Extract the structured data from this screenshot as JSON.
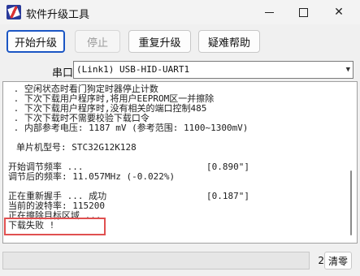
{
  "window": {
    "title": "软件升级工具",
    "minimize": "minimize",
    "maximize": "maximize",
    "close": "✕"
  },
  "toolbar": {
    "start_label": "开始升级",
    "stop_label": "停止",
    "retry_label": "重复升级",
    "help_label": "疑难帮助"
  },
  "port": {
    "label": "串口",
    "value": "(Link1) USB-HID-UART1"
  },
  "log": {
    "lines": [
      " . 空闲状态时看门狗定时器停止计数",
      " . 下次下载用户程序时,将用户EEPROM区一并擦除",
      " . 下次下载用户程序时,没有相关的端口控制485",
      " . 下次下载时不需要校验下载口令",
      " . 内部参考电压: 1187 mV (参考范围: 1100~1300mV)",
      "单片机型号: STC32G12K128",
      "开始调节频率 ...",
      "调节后的频率: 11.057MHz (-0.022%)",
      "正在重新握手 ... 成功",
      "当前的波特率: 115200",
      "正在擦除目标区域 ...",
      "下载失败 !"
    ],
    "timings": [
      "[0.890\"]",
      "[0.187\"]"
    ]
  },
  "status": {
    "count": "2",
    "clear_label": "清零"
  },
  "colors": {
    "accent": "#1b56c4",
    "highlight": "#e05050"
  }
}
